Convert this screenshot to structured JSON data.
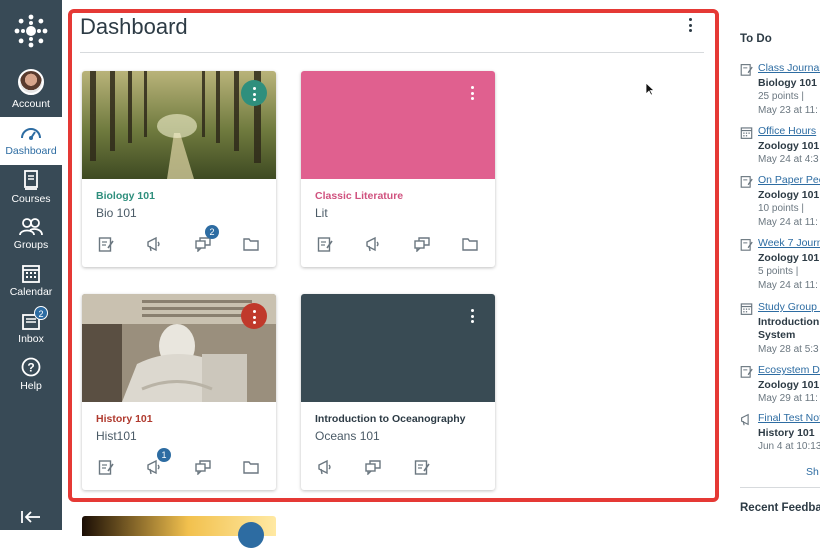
{
  "nav": {
    "items": [
      {
        "label": "Account",
        "icon": "avatar"
      },
      {
        "label": "Dashboard",
        "icon": "dashboard-icon"
      },
      {
        "label": "Courses",
        "icon": "book-icon"
      },
      {
        "label": "Groups",
        "icon": "groups-icon"
      },
      {
        "label": "Calendar",
        "icon": "calendar-icon"
      },
      {
        "label": "Inbox",
        "icon": "inbox-icon",
        "badge": "2"
      },
      {
        "label": "Help",
        "icon": "help-icon"
      }
    ]
  },
  "dashboard": {
    "title": "Dashboard",
    "cards": [
      {
        "code": "Biology 101",
        "name": "Bio 101",
        "color": "#2f8f7d",
        "discussion_badge": "2"
      },
      {
        "code": "Classic Literature",
        "name": "Lit",
        "color": "#e0608f"
      },
      {
        "code": "History 101",
        "name": "Hist101",
        "color": "#c0392b",
        "announcement_badge": "1"
      },
      {
        "code": "Introduction to Oceanography",
        "name": "Oceans 101",
        "color": "#394b54"
      }
    ]
  },
  "todo": {
    "heading": "To Do",
    "items": [
      {
        "title": "Class Journal",
        "course": "Biology 101",
        "points": "25 points  |",
        "date": "May 23 at 11:",
        "icon": "assignment-icon"
      },
      {
        "title": "Office Hours",
        "course": "Zoology 101",
        "date": "May 24 at 4:3",
        "icon": "calendar-icon"
      },
      {
        "title": "On Paper Pee",
        "course": "Zoology 101",
        "points": "10 points  |",
        "date": "May 24 at 11:",
        "icon": "assignment-icon"
      },
      {
        "title": "Week 7 Journ",
        "course": "Zoology 101",
        "points": "5 points  |",
        "date": "May 24 at 11:",
        "icon": "assignment-icon"
      },
      {
        "title": "Study Group M",
        "course": "Introduction t",
        "course2": "System",
        "date": "May 28 at 5:3",
        "icon": "calendar-icon"
      },
      {
        "title": "Ecosystem Di",
        "course": "Zoology 101",
        "date": "May 29 at 11:",
        "icon": "assignment-icon"
      },
      {
        "title": "Final Test Not",
        "course": "History 101",
        "date": "Jun 4 at 10:13",
        "icon": "announcement-icon"
      }
    ],
    "show_more": "Sh"
  },
  "feedback": {
    "heading": "Recent Feedba"
  }
}
